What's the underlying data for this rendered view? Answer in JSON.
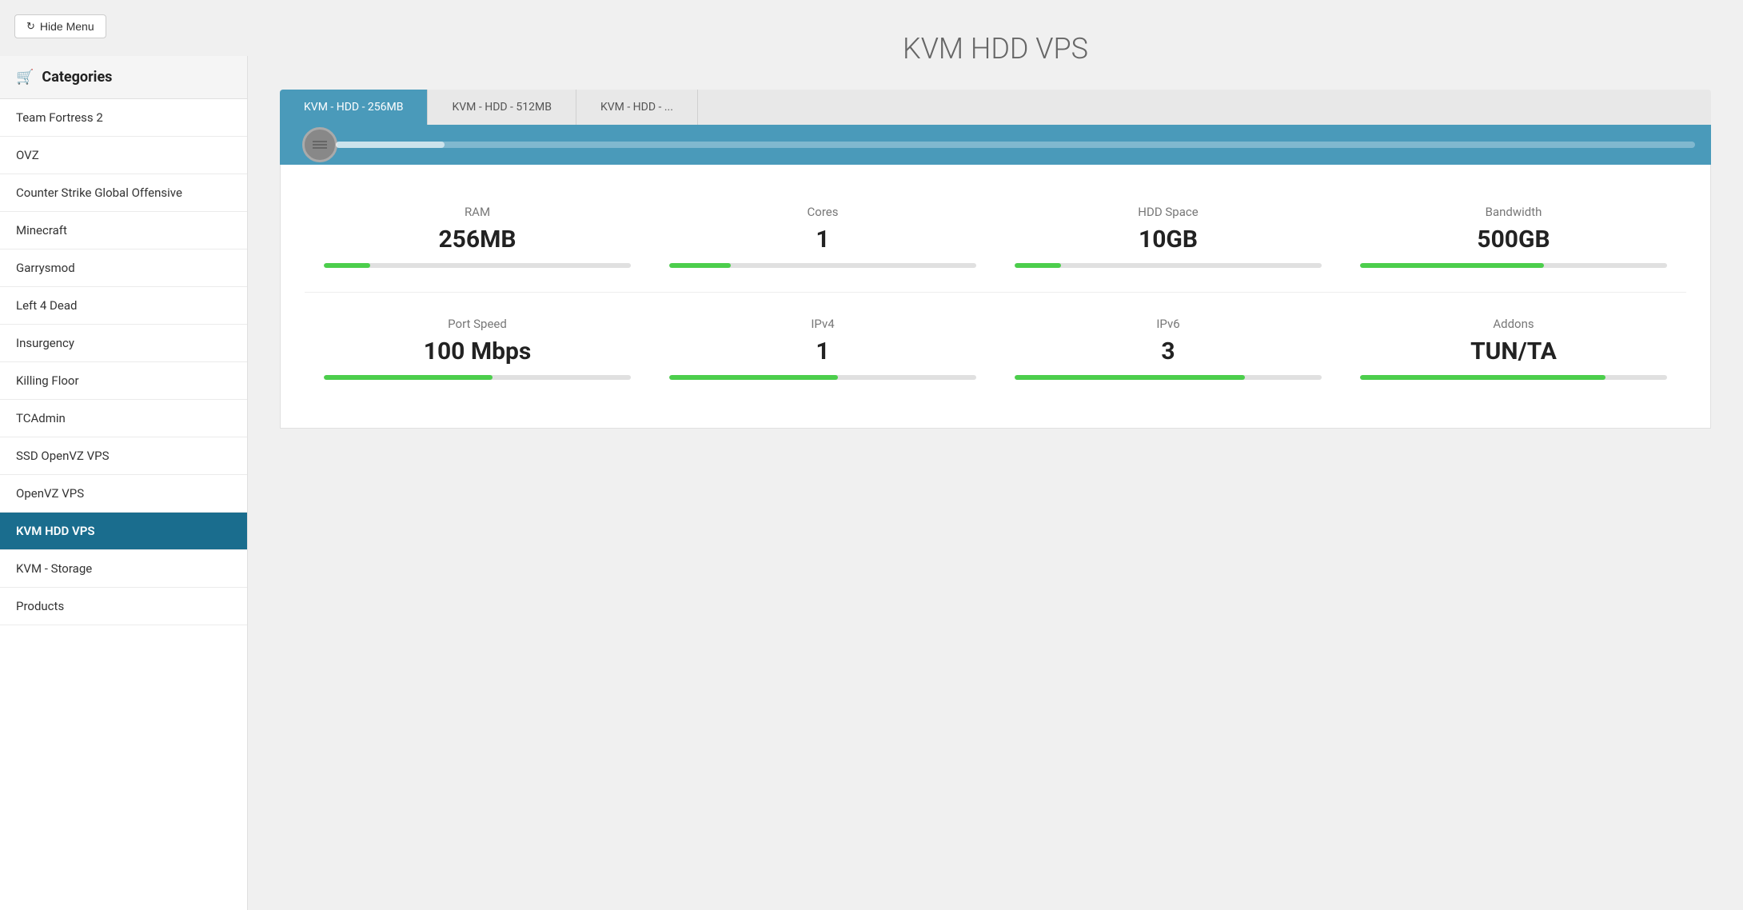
{
  "header": {
    "hide_menu_label": "Hide Menu"
  },
  "sidebar": {
    "title": "Categories",
    "items": [
      {
        "id": "team-fortress-2",
        "label": "Team Fortress 2",
        "active": false
      },
      {
        "id": "ovz",
        "label": "OVZ",
        "active": false
      },
      {
        "id": "counter-strike",
        "label": "Counter Strike Global Offensive",
        "active": false
      },
      {
        "id": "minecraft",
        "label": "Minecraft",
        "active": false
      },
      {
        "id": "garrysmod",
        "label": "Garrysmod",
        "active": false
      },
      {
        "id": "left-4-dead",
        "label": "Left 4 Dead",
        "active": false
      },
      {
        "id": "insurgency",
        "label": "Insurgency",
        "active": false
      },
      {
        "id": "killing-floor",
        "label": "Killing Floor",
        "active": false
      },
      {
        "id": "tcadmin",
        "label": "TCAdmin",
        "active": false
      },
      {
        "id": "ssd-openvz-vps",
        "label": "SSD OpenVZ VPS",
        "active": false
      },
      {
        "id": "openvz-vps",
        "label": "OpenVZ VPS",
        "active": false
      },
      {
        "id": "kvm-hdd-vps",
        "label": "KVM HDD VPS",
        "active": true
      },
      {
        "id": "kvm-storage",
        "label": "KVM - Storage",
        "active": false
      },
      {
        "id": "products",
        "label": "Products",
        "active": false
      }
    ]
  },
  "main": {
    "page_title": "KVM HDD VPS",
    "tabs": [
      {
        "id": "256mb",
        "label": "KVM - HDD - 256MB",
        "active": true
      },
      {
        "id": "512mb",
        "label": "KVM - HDD - 512MB",
        "active": false
      },
      {
        "id": "more",
        "label": "KVM - HDD - ...",
        "active": false
      }
    ],
    "specs": [
      {
        "label": "RAM",
        "value": "256MB",
        "bar_percent": 15
      },
      {
        "label": "Cores",
        "value": "1",
        "bar_percent": 20
      },
      {
        "label": "HDD Space",
        "value": "10GB",
        "bar_percent": 15
      },
      {
        "label": "Bandwidth",
        "value": "500GB",
        "bar_percent": 60
      },
      {
        "label": "Port Speed",
        "value": "100 Mbps",
        "bar_percent": 55
      },
      {
        "label": "IPv4",
        "value": "1",
        "bar_percent": 55
      },
      {
        "label": "IPv6",
        "value": "3",
        "bar_percent": 75
      },
      {
        "label": "Addons",
        "value": "TUN/TA",
        "bar_percent": 80
      }
    ]
  }
}
